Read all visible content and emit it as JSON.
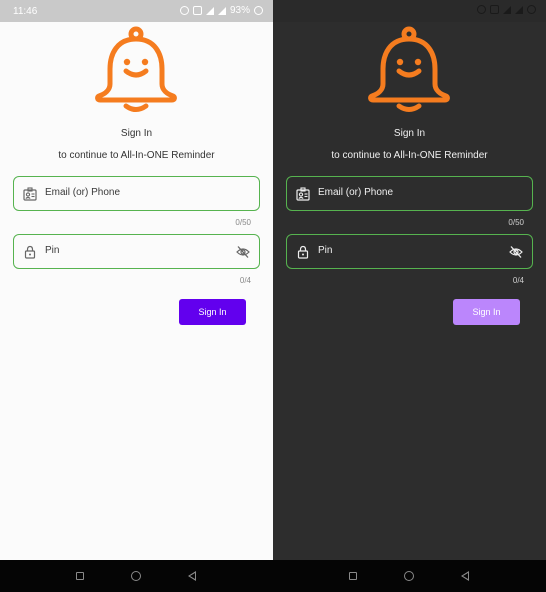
{
  "light": {
    "status_time": "11:46",
    "status_battery": "93%",
    "title": "Sign In",
    "subtitle": "to continue to All-In-ONE Reminder",
    "email_label": "Email (or) Phone",
    "email_counter": "0/50",
    "pin_label": "Pin",
    "pin_counter": "0/4",
    "signin_label": "Sign In"
  },
  "dark": {
    "title": "Sign In",
    "subtitle": "to continue to All-In-ONE Reminder",
    "email_label": "Email (or) Phone",
    "email_counter": "0/50",
    "pin_label": "Pin",
    "pin_counter": "0/4",
    "signin_label": "Sign In"
  },
  "colors": {
    "brand_orange": "#f57c1f",
    "field_border": "#56b34f",
    "primary_light": "#6200ee",
    "primary_dark": "#bb86fc"
  },
  "icons": [
    "bell-logo-icon",
    "contact-card-icon",
    "lock-icon",
    "eye-off-icon",
    "recents-icon",
    "home-icon",
    "back-icon"
  ]
}
